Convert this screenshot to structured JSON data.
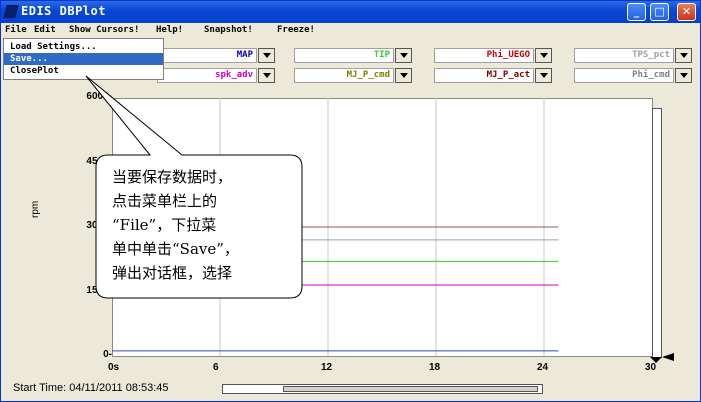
{
  "window": {
    "title": "EDIS DBPlot",
    "min_glyph": "_",
    "max_glyph": "□",
    "close_glyph": "✕"
  },
  "menubar": {
    "items": [
      "File",
      "Edit",
      "Show Cursors!",
      "Help!",
      "Snapshot!",
      "Freeze!"
    ]
  },
  "file_menu": {
    "items": [
      "Load Settings...",
      "Save...",
      "ClosePlot"
    ],
    "selected_index": 1
  },
  "channels": {
    "row1": [
      {
        "label": "MAP",
        "color": "#0000cc"
      },
      {
        "label": "TIP",
        "color": "#33cc33"
      },
      {
        "label": "Phi_UEGO",
        "color": "#cc0000"
      },
      {
        "label": "TPS_pct",
        "color": "#a0a0a0"
      }
    ],
    "row2": [
      {
        "label": "spk_adv",
        "color": "#cc00cc"
      },
      {
        "label": "MJ_P_cmd",
        "color": "#808000"
      },
      {
        "label": "MJ_P_act",
        "color": "#800000"
      },
      {
        "label": "Phi_cmd",
        "color": "#808080"
      }
    ]
  },
  "chart_data": {
    "type": "line",
    "ylabel": "rpm",
    "xlabel": "",
    "xlim": [
      0,
      30
    ],
    "ylim": [
      0,
      6000
    ],
    "x_ticks": [
      "0s",
      "6",
      "12",
      "18",
      "24",
      "30"
    ],
    "y_ticks": [
      "0",
      "1500",
      "3000",
      "4500",
      "6000"
    ],
    "grid": true,
    "series": [
      {
        "color": "#a05050",
        "x": [
          9.4,
          24.8
        ],
        "y": [
          3000,
          3000
        ]
      },
      {
        "color": "#a0a0a0",
        "x": [
          9.4,
          24.8
        ],
        "y": [
          2700,
          2700
        ]
      },
      {
        "color": "#33cc33",
        "x": [
          9.4,
          24.8
        ],
        "y": [
          2200,
          2200
        ]
      },
      {
        "color": "#cc00cc",
        "x": [
          9.4,
          24.8
        ],
        "y": [
          1650,
          1650
        ]
      },
      {
        "color": "#3344cc",
        "x": [
          0,
          24.8
        ],
        "y": [
          120,
          120
        ]
      }
    ]
  },
  "callout": {
    "lines": [
      "当要保存数据时，",
      "点击菜单栏上的",
      "“File”，下拉菜",
      "单中单击“Save”，",
      "弹出对话框，选择"
    ]
  },
  "footer": {
    "start_time": "Start Time: 04/11/2011 08:53:45"
  }
}
